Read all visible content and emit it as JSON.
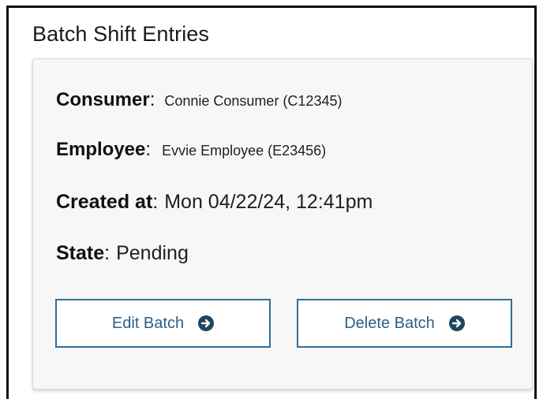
{
  "page": {
    "title": "Batch Shift Entries"
  },
  "details": {
    "consumer": {
      "label": "Consumer",
      "value": "Connie Consumer (C12345)"
    },
    "employee": {
      "label": "Employee",
      "value": "Evvie Employee (E23456)"
    },
    "created_at": {
      "label": "Created at",
      "value": "Mon 04/22/24, 12:41pm"
    },
    "state": {
      "label": "State",
      "value": "Pending"
    },
    "separator": ":"
  },
  "actions": {
    "edit": {
      "label": "Edit Batch",
      "icon": "arrow-right-circle-icon"
    },
    "delete": {
      "label": "Delete Batch",
      "icon": "arrow-right-circle-icon"
    }
  },
  "colors": {
    "accent": "#2f6f9a",
    "icon_fill": "#1f4560",
    "card_bg": "#f7f7f7"
  }
}
